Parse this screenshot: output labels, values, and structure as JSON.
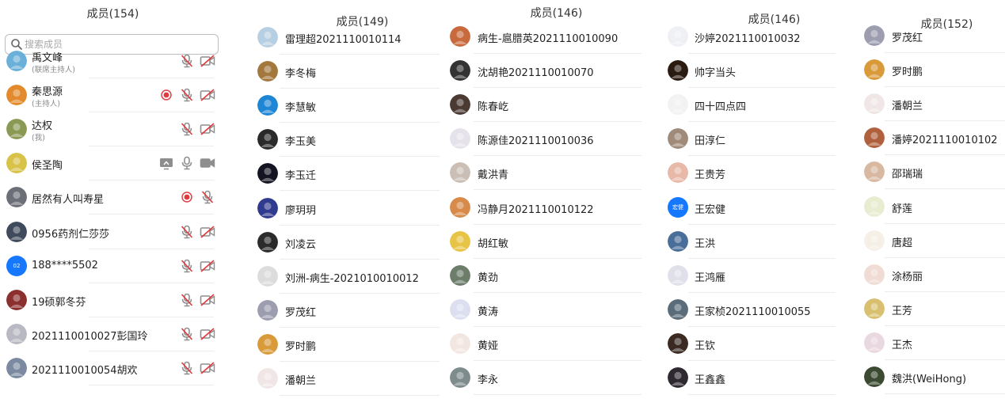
{
  "panels": [
    {
      "title": "成员(154)",
      "search_placeholder": "搜索成员",
      "members": [
        {
          "name": "禹文峰",
          "role": "(联席主持人)",
          "avatar": "#6bb0d8",
          "icons": [
            "mic-muted",
            "camera-off"
          ]
        },
        {
          "name": "秦思源",
          "role": "(主持人)",
          "avatar": "#e38b2c",
          "icons": [
            "recording",
            "mic-muted",
            "camera-off"
          ]
        },
        {
          "name": "达权",
          "role": "(我)",
          "avatar": "#8a9a54",
          "icons": [
            "mic-muted",
            "camera-off"
          ]
        },
        {
          "name": "侯圣陶",
          "role": "",
          "avatar": "#d8c248",
          "icons": [
            "screen-share",
            "mic",
            "camera"
          ]
        },
        {
          "name": "居然有人叫寿星",
          "role": "",
          "avatar": "#6c6f78",
          "icons": [
            "recording",
            "mic-muted"
          ]
        },
        {
          "name": "0956药剂仁莎莎",
          "role": "",
          "avatar": "#3f4a5c",
          "icons": [
            "mic-muted",
            "camera-off"
          ]
        },
        {
          "name": "188****5502",
          "role": "",
          "avatar": "badge",
          "badge_text": "02",
          "icons": [
            "mic-muted",
            "camera-off"
          ]
        },
        {
          "name": "19硕郭冬芬",
          "role": "",
          "avatar": "#8c2f2f",
          "icons": [
            "mic-muted",
            "camera-off"
          ]
        },
        {
          "name": "2021110010027彭国玲",
          "role": "",
          "avatar": "#b9b9c4",
          "icons": [
            "mic-muted",
            "camera-off"
          ]
        },
        {
          "name": "2021110010054胡欢",
          "role": "",
          "avatar": "#7b8aa0",
          "icons": [
            "mic-muted",
            "camera-off"
          ]
        }
      ]
    },
    {
      "title": "成员(149)",
      "members": [
        {
          "name": "雷理超2021110010114",
          "avatar": "#b7cfe3"
        },
        {
          "name": "李冬梅",
          "avatar": "#a2783c"
        },
        {
          "name": "李慧敏",
          "avatar": "#1f86d6"
        },
        {
          "name": "李玉美",
          "avatar": "#2a2a2a"
        },
        {
          "name": "李玉迁",
          "avatar": "#141422"
        },
        {
          "name": "廖玥玥",
          "avatar": "#2f3b8f"
        },
        {
          "name": "刘凌云",
          "avatar": "#2b2b2b"
        },
        {
          "name": "刘洲-病生-2021010010012",
          "avatar": "#dcdcdc"
        },
        {
          "name": "罗茂红",
          "avatar": "#9d9db0"
        },
        {
          "name": "罗时鹏",
          "avatar": "#d99a3a"
        },
        {
          "name": "潘朝兰",
          "avatar": "#f0e6e6"
        }
      ]
    },
    {
      "title": "成员(146)",
      "members": [
        {
          "name": "病生-扈腊英2021110010090",
          "avatar": "#c86a3c"
        },
        {
          "name": "沈胡艳2021110010070",
          "avatar": "#333333"
        },
        {
          "name": "陈春屹",
          "avatar": "#4a3a32"
        },
        {
          "name": "陈源佳2021110010036",
          "avatar": "#e6e2ec"
        },
        {
          "name": "戴洪青",
          "avatar": "#cbbfb5"
        },
        {
          "name": "冯静月2021110010122",
          "avatar": "#d88a4a"
        },
        {
          "name": "胡红敏",
          "avatar": "#e7c445"
        },
        {
          "name": "黄劲",
          "avatar": "#6c7d6a"
        },
        {
          "name": "黄涛",
          "avatar": "#dcdff0"
        },
        {
          "name": "黄娅",
          "avatar": "#f2e6e1"
        },
        {
          "name": "李永",
          "avatar": "#7f8c8d"
        }
      ]
    },
    {
      "title": "成员(146)",
      "members": [
        {
          "name": "沙婷2021110010032",
          "avatar": "#eef0f4"
        },
        {
          "name": "帅字当头",
          "avatar": "#2a1a10"
        },
        {
          "name": "四十四点四",
          "avatar": "#f2f2f2"
        },
        {
          "name": "田淳仁",
          "avatar": "#a08a7a"
        },
        {
          "name": "王贵芳",
          "avatar": "#e8b9a8"
        },
        {
          "name": "王宏健",
          "avatar": "badge",
          "badge_text": "宏健"
        },
        {
          "name": "王洪",
          "avatar": "#4a6e9a"
        },
        {
          "name": "王鸿雁",
          "avatar": "#e0e0ea"
        },
        {
          "name": "王家桢2021110010055",
          "avatar": "#5a6c7a"
        },
        {
          "name": "王钦",
          "avatar": "#3a2a22"
        },
        {
          "name": "王鑫鑫",
          "avatar": "#2e2830"
        }
      ]
    },
    {
      "title": "成员(152)",
      "members": [
        {
          "name": "罗茂红",
          "avatar": "#9d9db0"
        },
        {
          "name": "罗时鹏",
          "avatar": "#d99a3a"
        },
        {
          "name": "潘朝兰",
          "avatar": "#f0e6e6"
        },
        {
          "name": "潘婷2021110010102",
          "avatar": "#b0603c"
        },
        {
          "name": "邵瑞瑞",
          "avatar": "#d8b8a0"
        },
        {
          "name": "舒莲",
          "avatar": "#e8ecd0"
        },
        {
          "name": "唐超",
          "avatar": "#f5f0e6"
        },
        {
          "name": "涂杨丽",
          "avatar": "#f0dcd4"
        },
        {
          "name": "王芳",
          "avatar": "#d8c070"
        },
        {
          "name": "王杰",
          "avatar": "#ead8e0"
        },
        {
          "name": "魏洪(WeiHong)",
          "avatar": "#3c4a32"
        }
      ]
    }
  ],
  "colors": {
    "mic_gray": "#8e8e8e",
    "mute_red": "#e0393e",
    "record_red": "#e0393e",
    "badge_blue": "#1677ff"
  }
}
